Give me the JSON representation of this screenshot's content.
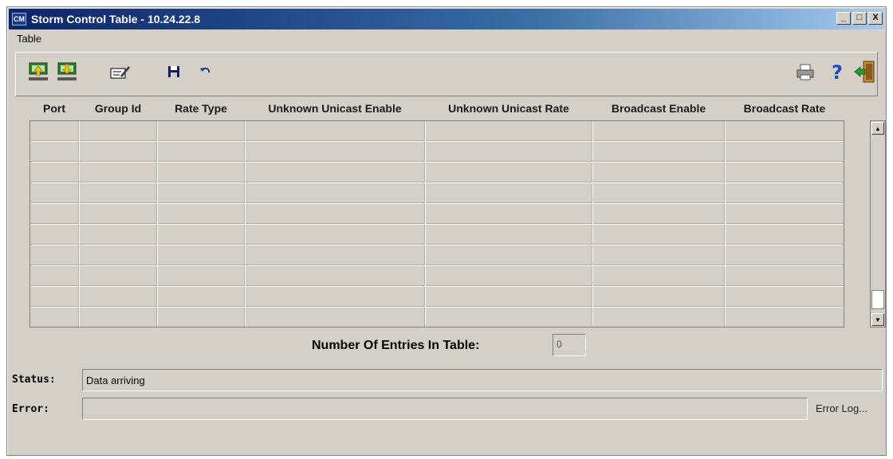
{
  "window": {
    "title": "Storm Control Table - 10.24.22.8",
    "app_icon_text": "CM",
    "buttons": {
      "minimize": "_",
      "maximize": "□",
      "close": "X"
    }
  },
  "menu": {
    "items": [
      {
        "label": "Table"
      }
    ]
  },
  "toolbar": {
    "icons": [
      "upload-icon",
      "download-icon",
      "edit-icon",
      "save-icon",
      "undo-icon",
      "print-icon",
      "help-icon",
      "exit-icon"
    ]
  },
  "table": {
    "columns": [
      "Port",
      "Group Id",
      "Rate Type",
      "Unknown Unicast Enable",
      "Unknown Unicast Rate",
      "Broadcast Enable",
      "Broadcast Rate"
    ],
    "rows": [
      [
        "",
        "",
        "",
        "",
        "",
        "",
        ""
      ],
      [
        "",
        "",
        "",
        "",
        "",
        "",
        ""
      ],
      [
        "",
        "",
        "",
        "",
        "",
        "",
        ""
      ],
      [
        "",
        "",
        "",
        "",
        "",
        "",
        ""
      ],
      [
        "",
        "",
        "",
        "",
        "",
        "",
        ""
      ],
      [
        "",
        "",
        "",
        "",
        "",
        "",
        ""
      ],
      [
        "",
        "",
        "",
        "",
        "",
        "",
        ""
      ],
      [
        "",
        "",
        "",
        "",
        "",
        "",
        ""
      ],
      [
        "",
        "",
        "",
        "",
        "",
        "",
        ""
      ],
      [
        "",
        "",
        "",
        "",
        "",
        "",
        ""
      ]
    ]
  },
  "entries": {
    "label": "Number Of Entries In Table:",
    "value": "0"
  },
  "status": {
    "label": "Status:",
    "value": "Data arriving"
  },
  "error": {
    "label": "Error:",
    "value": "",
    "log_link": "Error Log..."
  },
  "colors": {
    "titlebar_start": "#0a246a",
    "titlebar_end": "#a6caf0",
    "face": "#d4d0c8"
  }
}
